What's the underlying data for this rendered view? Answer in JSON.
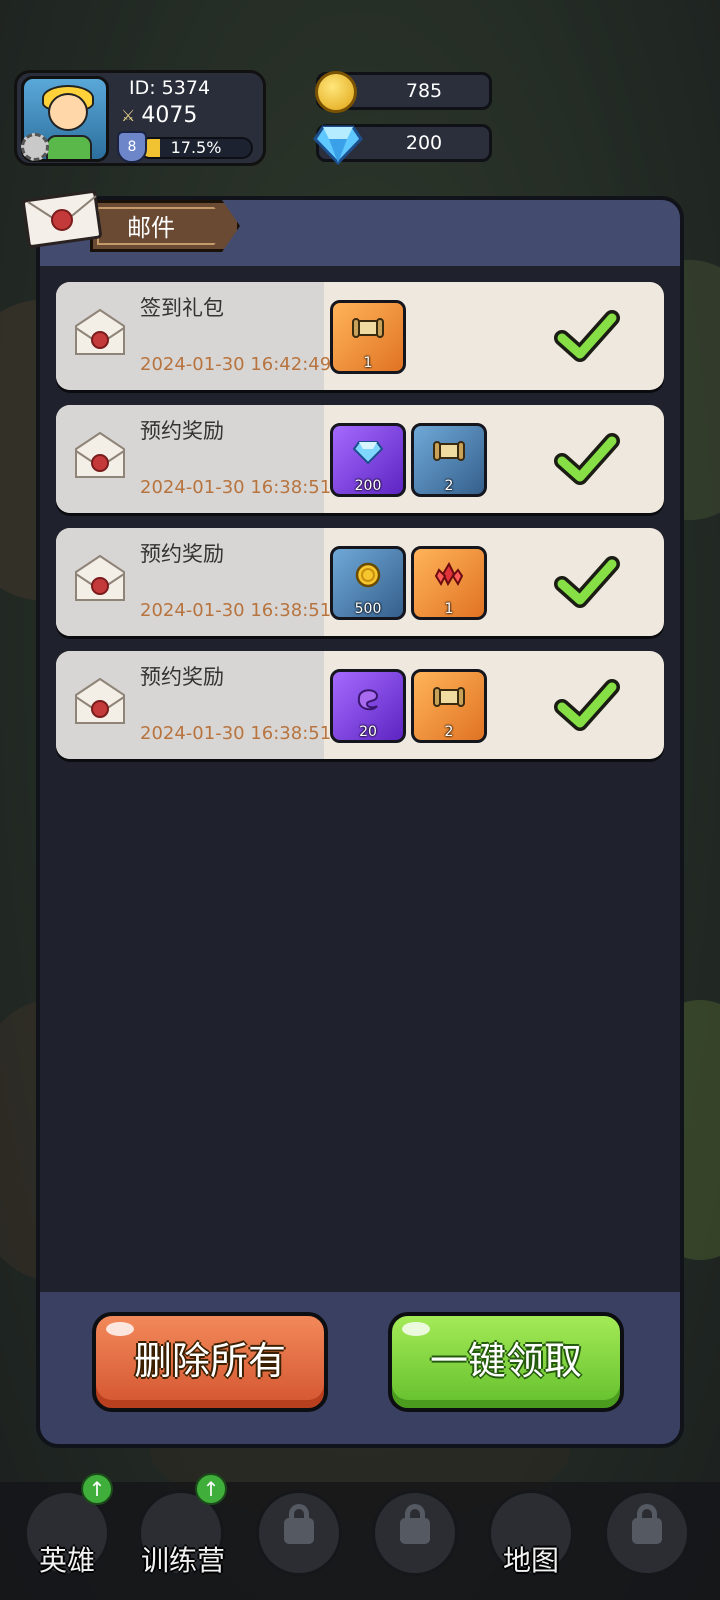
{
  "player": {
    "id_label": "ID:  5374",
    "power": "4075",
    "level": "8",
    "xp_text": "17.5%",
    "xp_fraction": 0.175
  },
  "resources": {
    "gold": "785",
    "diamond": "200"
  },
  "mail_panel": {
    "title": "邮件",
    "mails": [
      {
        "name": "签到礼包",
        "date": "2024-01-30 16:42:49",
        "items": [
          {
            "icon": "scroll-icon",
            "bg": "orange",
            "count": "1"
          }
        ],
        "claimed": true
      },
      {
        "name": "预约奖励",
        "date": "2024-01-30 16:38:51",
        "items": [
          {
            "icon": "diamond-icon",
            "bg": "purple",
            "count": "200"
          },
          {
            "icon": "scroll-icon",
            "bg": "blue",
            "count": "2"
          }
        ],
        "claimed": true
      },
      {
        "name": "预约奖励",
        "date": "2024-01-30 16:38:51",
        "items": [
          {
            "icon": "gold-coin-icon",
            "bg": "blue",
            "count": "500"
          },
          {
            "icon": "red-crystal-icon",
            "bg": "orange",
            "count": "1"
          }
        ],
        "claimed": true
      },
      {
        "name": "预约奖励",
        "date": "2024-01-30 16:38:51",
        "items": [
          {
            "icon": "purple-material-icon",
            "bg": "purple",
            "count": "20"
          },
          {
            "icon": "scroll-icon",
            "bg": "orange",
            "count": "2"
          }
        ],
        "claimed": true
      }
    ],
    "delete_all_label": "删除所有",
    "claim_all_label": "一键领取"
  },
  "bottom_nav": [
    {
      "label": "英雄",
      "locked": false,
      "has_upgrade": true
    },
    {
      "label": "训练营",
      "locked": false,
      "has_upgrade": true
    },
    {
      "label": "",
      "locked": true,
      "has_upgrade": false
    },
    {
      "label": "",
      "locked": true,
      "has_upgrade": false
    },
    {
      "label": "地图",
      "locked": false,
      "has_upgrade": false
    },
    {
      "label": "",
      "locked": true,
      "has_upgrade": false
    }
  ],
  "colors": {
    "panel_bg": "#1f212c",
    "header_bg": "#434b6e",
    "date_text": "#b7743f",
    "delete_button": "#e0673c",
    "claim_button": "#84d541"
  }
}
